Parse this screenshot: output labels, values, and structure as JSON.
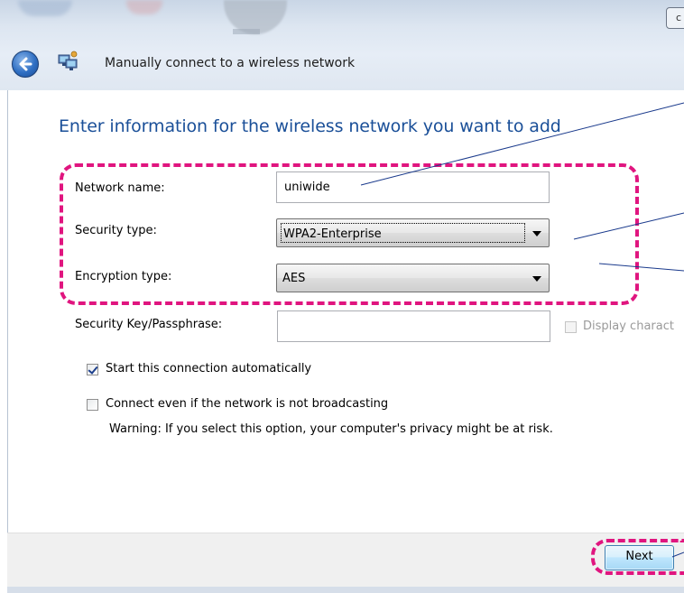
{
  "window": {
    "title": "Manually connect to a wireless network",
    "top_control_glyph": "c"
  },
  "page": {
    "heading": "Enter information for the wireless network you want to add"
  },
  "form": {
    "network_name": {
      "label": "Network name:",
      "value": "uniwide"
    },
    "security_type": {
      "label": "Security type:",
      "value": "WPA2-Enterprise"
    },
    "encryption_type": {
      "label": "Encryption type:",
      "value": "AES"
    },
    "security_key": {
      "label": "Security Key/Passphrase:",
      "value": ""
    },
    "display_characters": {
      "label": "Display charact",
      "checked": false,
      "enabled": false
    }
  },
  "options": {
    "start_automatically": {
      "label": "Start this connection automatically",
      "checked": true
    },
    "connect_not_broadcasting": {
      "label": "Connect even if the network is not broadcasting",
      "checked": false
    },
    "warning": "Warning: If you select this option, your computer's privacy might be at risk."
  },
  "footer": {
    "next_label": "Next"
  },
  "icons": [
    "back-arrow-icon",
    "network-icon",
    "dropdown-arrow-icon",
    "checkbox-icon"
  ],
  "colors": {
    "heading": "#1a4f98",
    "annotation": "#e0157f",
    "annotation_line": "#1a3a8c"
  }
}
